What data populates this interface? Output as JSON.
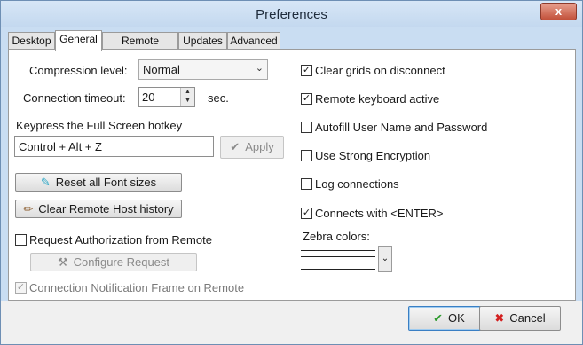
{
  "window": {
    "title": "Preferences",
    "close_glyph": "x"
  },
  "tabs": [
    {
      "label": "Desktop"
    },
    {
      "label": "General",
      "active": true
    },
    {
      "label": "Remote Service"
    },
    {
      "label": "Updates"
    },
    {
      "label": "Advanced"
    }
  ],
  "general": {
    "compression_label": "Compression level:",
    "compression_value": "Normal",
    "timeout_label": "Connection timeout:",
    "timeout_value": "20",
    "timeout_unit": "sec.",
    "hotkey_label": "Keypress the Full Screen hotkey",
    "hotkey_value": "Control + Alt + Z",
    "apply_label": "Apply",
    "reset_fonts_label": "Reset all Font sizes",
    "clear_history_label": "Clear Remote Host history",
    "request_auth_label": "Request Authorization from Remote",
    "configure_request_label": "Configure Request",
    "notification_frame_label": "Connection Notification Frame on Remote"
  },
  "options": [
    {
      "label": "Clear grids on disconnect",
      "checked": true
    },
    {
      "label": "Remote keyboard active",
      "checked": true
    },
    {
      "label": "Autofill User Name and Password",
      "checked": false
    },
    {
      "label": "Use Strong Encryption",
      "checked": false
    },
    {
      "label": "Log connections",
      "checked": false
    },
    {
      "label": "Connects with <ENTER>",
      "checked": true
    }
  ],
  "zebra": {
    "label": "Zebra colors:"
  },
  "footer": {
    "ok_label": "OK",
    "cancel_label": "Cancel"
  },
  "colors": {
    "ok_check": "#2e9a2e",
    "cancel_x": "#d32020"
  }
}
